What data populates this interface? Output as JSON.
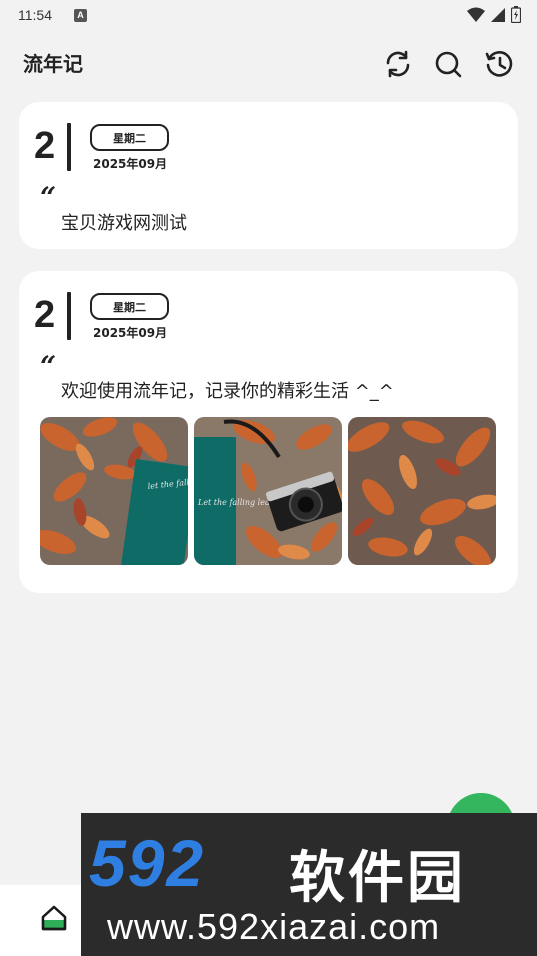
{
  "status_bar": {
    "time": "11:54",
    "notification_badge": "A",
    "icons": [
      "wifi-icon",
      "signal-icon",
      "battery-icon"
    ]
  },
  "header": {
    "title": "流年记",
    "actions": [
      "refresh-icon",
      "search-icon",
      "history-icon"
    ]
  },
  "entries": [
    {
      "day": "2",
      "weekday": "星期二",
      "month": "2025年09月",
      "quote_mark": "“",
      "text": "宝贝游戏网测试",
      "photos": []
    },
    {
      "day": "2",
      "weekday": "星期二",
      "month": "2025年09月",
      "quote_mark": "“",
      "text": "欢迎使用流年记，记录你的精彩生活 ^_^",
      "photos": [
        "autumn leaves with teal notebook",
        "autumn leaves with black camera",
        "autumn leaves"
      ],
      "notebook_text": "Let the falling leaves"
    }
  ],
  "fab": {
    "color": "#33b65e"
  },
  "bottom_nav": {
    "home_icon": "home-icon"
  },
  "watermark": {
    "number": "592",
    "name": "软件园",
    "url": "www.592xiazai.com"
  },
  "colors": {
    "background": "#f2f2f2",
    "card": "#ffffff",
    "text": "#222222",
    "accent": "#33b65e",
    "watermark_blue": "#2f7fe3"
  }
}
